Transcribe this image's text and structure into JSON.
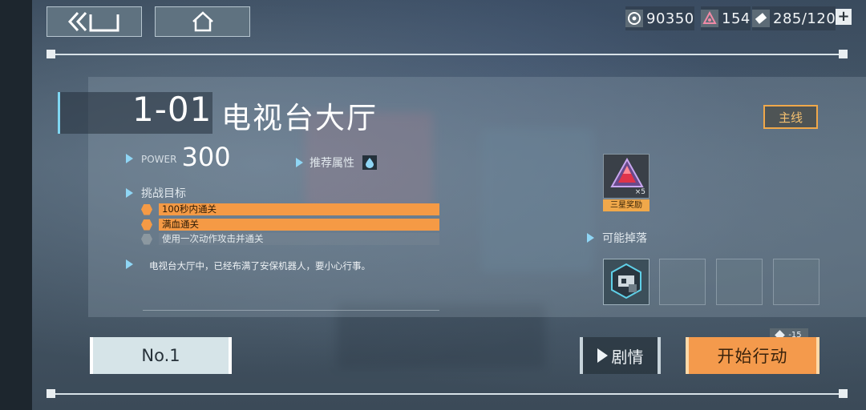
{
  "topbar": {
    "resources": [
      {
        "icon": "gold-coin-icon",
        "value": "90350"
      },
      {
        "icon": "gem-icon",
        "value": "154"
      },
      {
        "icon": "energy-ticket-icon",
        "value": "285/120"
      }
    ],
    "plus": "+"
  },
  "stage": {
    "number": "1-01",
    "name": "电视台大厅",
    "tag": "主线",
    "power_label": "POWER",
    "power_value": "300",
    "recommend_label": "推荐属性",
    "challenge_label": "挑战目标",
    "objectives": [
      {
        "text": "100秒内通关",
        "done": true
      },
      {
        "text": "满血通关",
        "done": true
      },
      {
        "text": "使用一次动作攻击并通关",
        "done": false
      }
    ],
    "description": "电视台大厅中，已经布满了安保机器人，要小心行事。"
  },
  "rewards": {
    "star_reward_label": "三星奖励",
    "star_reward_count": "×5",
    "drop_label": "可能掉落"
  },
  "actions": {
    "rank_label": "No.1",
    "story_label": "剧情",
    "start_label": "开始行动",
    "cost": "-15"
  },
  "colors": {
    "accent_orange": "#f59a45",
    "accent_cyan": "#8fd6f5",
    "panel_bg": "#5f7280"
  }
}
